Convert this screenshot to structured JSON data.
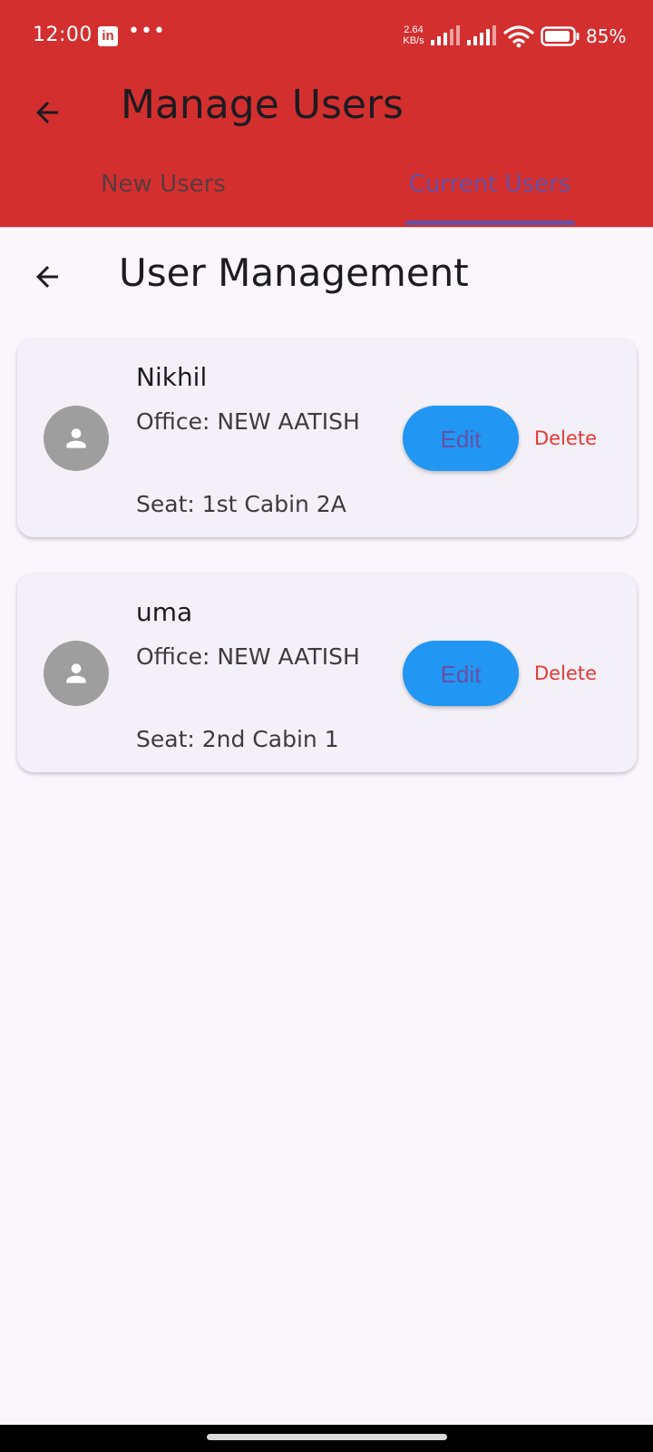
{
  "status_bar": {
    "time": "12:00",
    "linkedin_badge": "in",
    "more": "•••",
    "net_speed_value": "2.64",
    "net_speed_unit": "KB/s",
    "battery_text": "85%",
    "icons": [
      "linkedin-icon",
      "more-icon",
      "signal-icon",
      "signal-icon",
      "wifi-icon",
      "battery-icon"
    ]
  },
  "app_bar": {
    "title": "Manage Users",
    "back_icon": "arrow-back-icon",
    "color": "#d32f2f"
  },
  "tabs": [
    {
      "label": "New Users",
      "selected": false
    },
    {
      "label": "Current Users",
      "selected": true
    }
  ],
  "page": {
    "title": "User Management",
    "back_icon": "arrow-back-icon"
  },
  "users": [
    {
      "name": "Nikhil",
      "office": "Office: NEW AATISH",
      "seat": "Seat: 1st Cabin 2A",
      "edit_label": "Edit",
      "delete_label": "Delete"
    },
    {
      "name": "uma",
      "office": "Office: NEW AATISH",
      "seat": "Seat: 2nd Cabin 1",
      "edit_label": "Edit",
      "delete_label": "Delete"
    }
  ],
  "colors": {
    "accent": "#6750a4",
    "edit_button": "#2196f3",
    "delete_text": "#e53935",
    "avatar": "#9e9e9e",
    "background": "#fbf5fc"
  }
}
